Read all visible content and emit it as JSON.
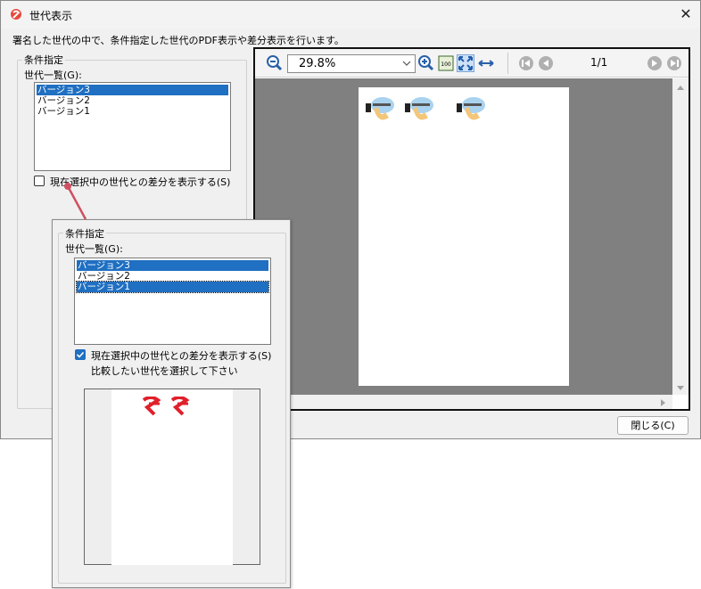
{
  "window": {
    "title": "世代表示",
    "close_glyph": "✕",
    "description": "署名した世代の中で、条件指定した世代のPDF表示や差分表示を行います。"
  },
  "conditions": {
    "group_label": "条件指定",
    "list_label": "世代一覧(G):",
    "generations": [
      "バージョン3",
      "バージョン2",
      "バージョン1"
    ],
    "selected_index": 0,
    "diff_checkbox_label": "現在選択中の世代との差分を表示する(S)",
    "diff_checked": false
  },
  "viewer": {
    "zoom": "29.8%",
    "page_indicator": "1/1",
    "toolbar_icons": [
      "zoom-out-icon",
      "zoom-in-icon",
      "actual-size-icon",
      "fit-page-icon",
      "fit-width-icon",
      "first-page-icon",
      "prev-page-icon",
      "next-page-icon",
      "last-page-icon"
    ],
    "page_stamp_count": 3
  },
  "close_button": "閉じる(C)",
  "popup": {
    "group_label": "条件指定",
    "list_label": "世代一覧(G):",
    "generations": [
      "バージョン3",
      "バージョン2",
      "バージョン1"
    ],
    "selected_indices": [
      0,
      2
    ],
    "diff_checkbox_label": "現在選択中の世代との差分を表示する(S)",
    "diff_checked": true,
    "hint": "比較したい世代を選択して下さい"
  },
  "colors": {
    "selection": "#1f6fc2",
    "callout": "#d05062",
    "viewer_background": "#808080",
    "diff_mark": "#e0202a"
  }
}
